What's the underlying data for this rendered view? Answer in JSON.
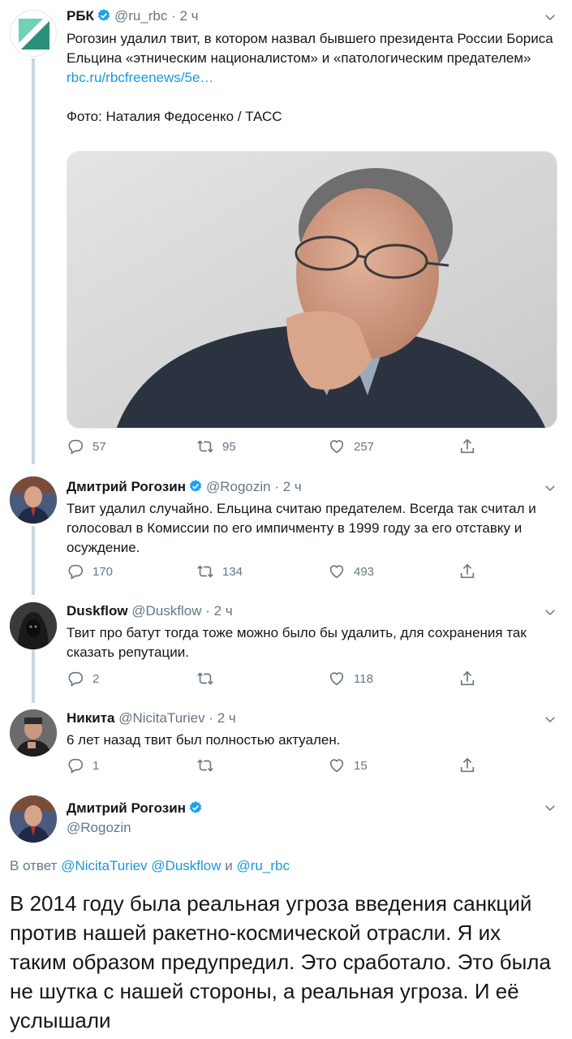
{
  "colors": {
    "link": "#1b95e0",
    "muted": "#657786",
    "verified": "#1da1f2",
    "line": "#ccd6dd"
  },
  "tweets": [
    {
      "name": "РБК",
      "handle": "@ru_rbc",
      "time": "2 ч",
      "text": "Рогозин удалил твит, в котором назвал бывшего президента России Бориса Ельцина «этническим националистом» и «патологическим предателем»",
      "link": "rbc.ru/rbcfreenews/5e…",
      "caption": "Фото: Наталия Федосенко / ТАСС",
      "replies": "57",
      "retweets": "95",
      "likes": "257"
    },
    {
      "name": "Дмитрий Рогозин",
      "handle": "@Rogozin",
      "time": "2 ч",
      "text": "Твит удалил случайно. Ельцина считаю предателем. Всегда так считал и голосовал в Комиссии по его импичменту в 1999 году за его отставку и осуждение.",
      "replies": "170",
      "retweets": "134",
      "likes": "493"
    },
    {
      "name": "Duskflow",
      "handle": "@Duskflow",
      "time": "2 ч",
      "text": "Твит про батут тогда тоже можно было бы удалить, для сохранения так сказать репутации.",
      "replies": "2",
      "retweets": "",
      "likes": "118"
    },
    {
      "name": "Никита",
      "handle": "@NicitaTuriev",
      "time": "2 ч",
      "text": "6 лет назад твит был полностью актуален.",
      "replies": "1",
      "retweets": "",
      "likes": "15"
    }
  ],
  "main": {
    "name": "Дмитрий Рогозин",
    "handle": "@Rogozin",
    "reply_prefix": "В ответ",
    "reply_user1": "@NicitaTuriev",
    "reply_user2": "@Duskflow",
    "reply_and": "и",
    "reply_user3": "@ru_rbc",
    "text": "В 2014 году была реальная угроза введения санкций против нашей ракетно-космической отрасли. Я их таким образом предупредил. Это сработало. Это была не шутка с нашей стороны, а реальная угроза. И её услышали"
  }
}
